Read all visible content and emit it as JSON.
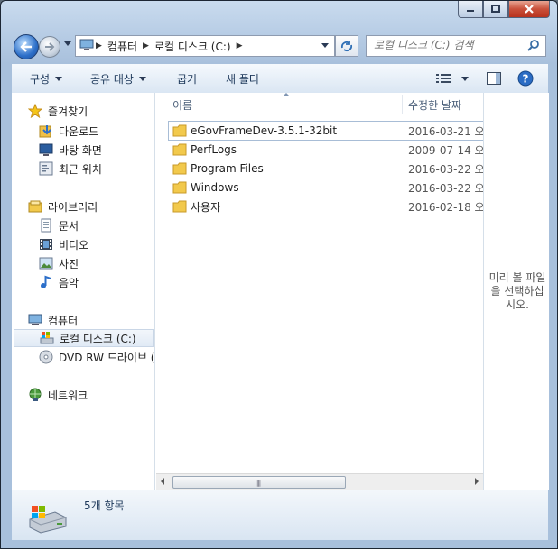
{
  "address": {
    "crumbs": [
      "컴퓨터",
      "로컬 디스크 (C:)"
    ]
  },
  "search": {
    "placeholder": "로컬 디스크 (C:) 검색"
  },
  "toolbar": {
    "organize": "구성",
    "share": "공유 대상",
    "burn": "굽기",
    "new_folder": "새 폴더"
  },
  "nav": {
    "favorites": "즐겨찾기",
    "downloads": "다운로드",
    "desktop": "바탕 화면",
    "recent": "최근 위치",
    "libraries": "라이브러리",
    "documents": "문서",
    "videos": "비디오",
    "pictures": "사진",
    "music": "음악",
    "computer": "컴퓨터",
    "local_disk": "로컬 디스크 (C:)",
    "dvd": "DVD RW 드라이브 (",
    "network": "네트워크"
  },
  "columns": {
    "name": "이름",
    "date": "수정한 날짜"
  },
  "files": [
    {
      "name": "eGovFrameDev-3.5.1-32bit",
      "date": "2016-03-21 오"
    },
    {
      "name": "PerfLogs",
      "date": "2009-07-14 오"
    },
    {
      "name": "Program Files",
      "date": "2016-03-22 오"
    },
    {
      "name": "Windows",
      "date": "2016-03-22 오"
    },
    {
      "name": "사용자",
      "date": "2016-02-18 오"
    }
  ],
  "preview": {
    "text": "미리 볼 파일을 선택하십시오."
  },
  "details": {
    "count": "5개 항목"
  },
  "colors": {
    "selection_border": "#a8bdd6",
    "folder": "#f2c94c",
    "accent": "#2c6fc9"
  }
}
